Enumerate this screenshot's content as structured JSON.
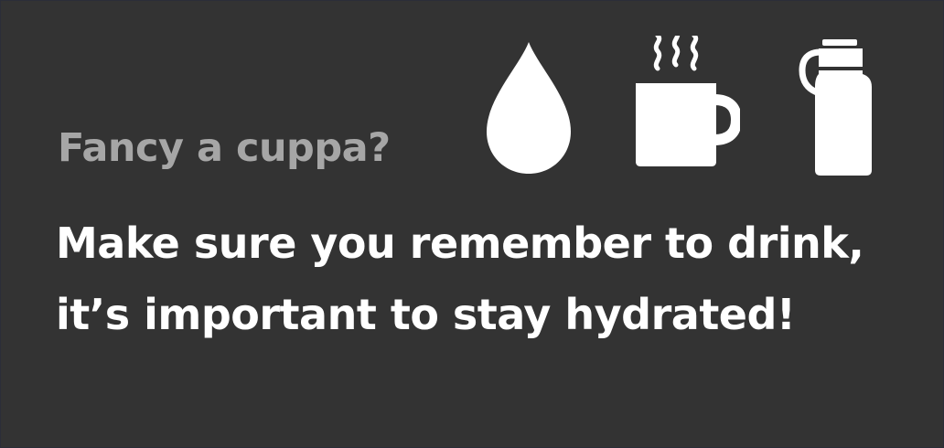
{
  "card": {
    "subtitle": "Fancy a cuppa?",
    "message_lines": [
      "Make sure you remember to drink,",
      "it’s important to stay hydrated!"
    ]
  },
  "icons": [
    "water-drop-icon",
    "steaming-mug-icon",
    "water-bottle-icon"
  ],
  "colors": {
    "background": "#333333",
    "subtitle_text": "#a6a6a6",
    "message_text": "#ffffff",
    "icon_fill": "#ffffff"
  }
}
